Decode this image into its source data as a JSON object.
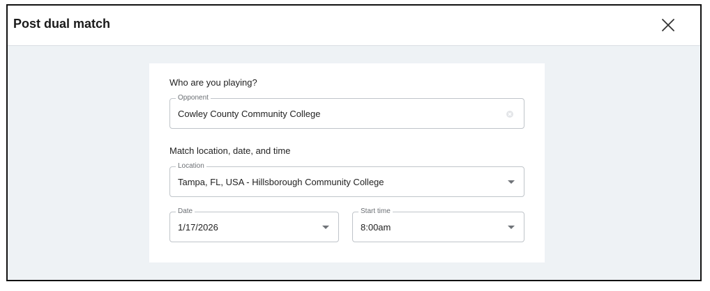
{
  "dialog": {
    "title": "Post dual match"
  },
  "opponent_section": {
    "heading": "Who are you playing?",
    "field": {
      "label": "Opponent",
      "value": "Cowley County Community College"
    }
  },
  "schedule_section": {
    "heading": "Match location, date, and time",
    "location": {
      "label": "Location",
      "value": "Tampa, FL, USA - Hillsborough Community College"
    },
    "date": {
      "label": "Date",
      "value": "1/17/2026"
    },
    "start_time": {
      "label": "Start time",
      "value": "8:00am"
    }
  },
  "icons": {
    "close": "close-icon",
    "clear": "clear-circle-icon",
    "dropdown": "caret-down-icon"
  },
  "colors": {
    "backdrop": "#eef2f5",
    "border": "#bfc4c9",
    "text": "#1f1f1f"
  }
}
